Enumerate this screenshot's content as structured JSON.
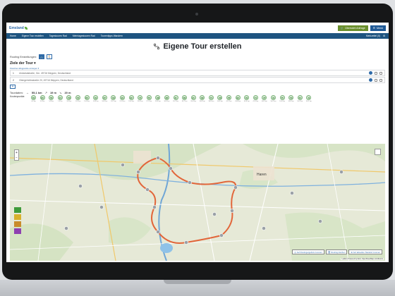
{
  "header": {
    "logo_text": "Emsland",
    "cart_label": "Übersicht Anfrage",
    "menu_label": "Menü"
  },
  "nav": {
    "items": [
      "Home",
      "Eigene Tour erstellen",
      "Tagestouren Rad",
      "Mehrtagestouren Rad",
      "Tourentipps Wandern"
    ],
    "right_label": "Merkzettel (0)"
  },
  "page": {
    "title": "Eigene Tour erstellen"
  },
  "routing": {
    "label": "Routing Einstellungen:",
    "bike_icon": "bicycle-icon",
    "walk_icon": "walking-icon"
  },
  "ziele": {
    "label": "Ziele der Tour",
    "waypoint_link": "Zwischen-Wegpunkte anzeigen ▾",
    "waypoints": [
      {
        "num": "1",
        "address": "Ulckstralstraße, Gm. 49716 Meppen, Deutschland"
      },
      {
        "num": "2",
        "address": "Obergerichtsstraße 20, 49716 Meppen, Deutschland"
      }
    ],
    "add_label": "+"
  },
  "tour": {
    "label": "Tourdaten:",
    "distance": "55,1 km",
    "up": "19 m",
    "down": "20 m",
    "knoten_label": "Knotenpunkte:",
    "knoten": [
      {
        "n": "64",
        "d": "0,0 km"
      },
      {
        "n": "60",
        "d": "3,3 km"
      },
      {
        "n": "53",
        "d": "5,8 km"
      },
      {
        "n": "44",
        "d": "7,4 km"
      },
      {
        "n": "50",
        "d": "9,0 km"
      },
      {
        "n": "73",
        "d": "11,3 km"
      },
      {
        "n": "60",
        "d": "13,6 km"
      },
      {
        "n": "61",
        "d": "15,8 km"
      },
      {
        "n": "67",
        "d": "18,0 km"
      },
      {
        "n": "62",
        "d": "19,2 km"
      },
      {
        "n": "94",
        "d": "21,5 km"
      },
      {
        "n": "32",
        "d": "23,6 km"
      },
      {
        "n": "74",
        "d": "25,3 km"
      },
      {
        "n": "76",
        "d": "27,1 km"
      },
      {
        "n": "38",
        "d": "29,0 km"
      },
      {
        "n": "28",
        "d": "30,5 km"
      },
      {
        "n": "41",
        "d": "32,2 km"
      },
      {
        "n": "80",
        "d": "33,7 km"
      },
      {
        "n": "31",
        "d": "35,0 km"
      },
      {
        "n": "82",
        "d": "36,9 km"
      },
      {
        "n": "74",
        "d": "38,5 km"
      },
      {
        "n": "36",
        "d": "40,4 km"
      },
      {
        "n": "78",
        "d": "42,1 km"
      },
      {
        "n": "93",
        "d": "43,8 km"
      },
      {
        "n": "61",
        "d": "45,4 km"
      },
      {
        "n": "74",
        "d": "47,0 km"
      },
      {
        "n": "27",
        "d": "48,5 km"
      },
      {
        "n": "44",
        "d": "50,2 km"
      },
      {
        "n": "75",
        "d": "51,6 km"
      },
      {
        "n": "53",
        "d": "53,0 km"
      },
      {
        "n": "64",
        "d": "54,2 km"
      },
      {
        "n": "11",
        "d": "55,1 km"
      }
    ]
  },
  "map": {
    "route_color": "#e2663a",
    "place_label": "Haren",
    "tool_1": "Auf Routingergebnis zoomen",
    "tool_2": "Routing löschen",
    "tool_3": "Auf aktuellen Standort zoomen",
    "attribution": "Leaflet | Powered by Esri | OpenStreetMap contributors"
  },
  "colors": {
    "nav_bg": "#1e5480",
    "accent": "#2e6aa8",
    "cart_bg": "#6a8f2c"
  }
}
